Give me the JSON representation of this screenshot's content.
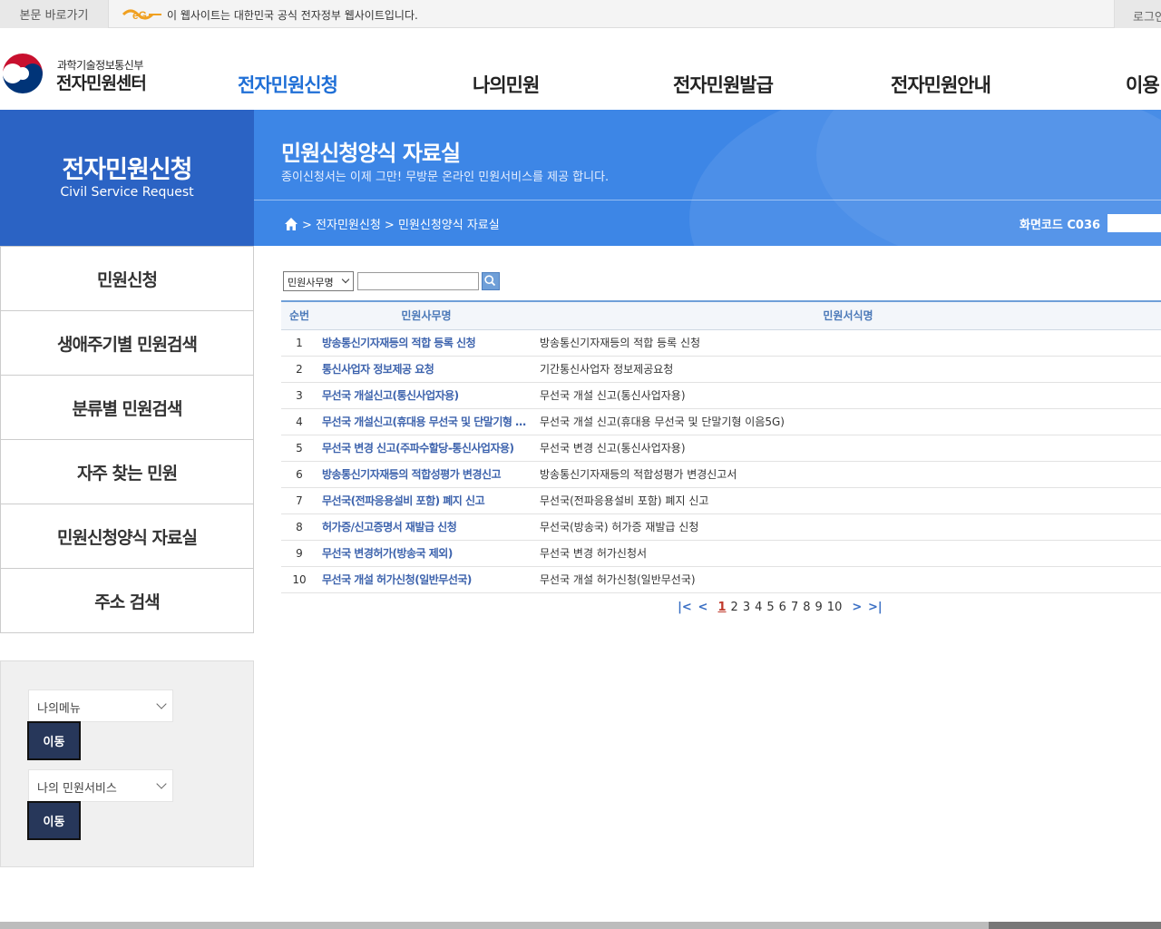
{
  "topbar": {
    "skip_link": "본문 바로가기",
    "notice": "이 웹사이트는 대한민국 공식 전자정부 웹사이트입니다.",
    "login": "로그인"
  },
  "header": {
    "ministry": "과학기술정보통신부",
    "center_name": "전자민원센터",
    "gnb": [
      "전자민원신청",
      "나의민원",
      "전자민원발급",
      "전자민원안내",
      "이용"
    ]
  },
  "left_title": {
    "ko": "전자민원신청",
    "en": "Civil Service Request"
  },
  "banner": {
    "title": "민원신청양식 자료실",
    "subtitle": "종이신청서는 이제 그만! 무방문 온라인 민원서비스를 제공 합니다.",
    "breadcrumb": "> 전자민원신청 > 민원신청양식 자료실",
    "screen_code": "화면코드 C036"
  },
  "lnb": [
    "민원신청",
    "생애주기별 민원검색",
    "분류별 민원검색",
    "자주 찾는 민원",
    "민원신청양식 자료실",
    "주소 검색"
  ],
  "mymenu": {
    "select1": "나의메뉴",
    "select2": "나의 민원서비스",
    "go_label": "이동"
  },
  "search": {
    "select_value": "민원사무명",
    "input_value": ""
  },
  "table": {
    "headers": [
      "순번",
      "민원사무명",
      "민원서식명"
    ],
    "rows": [
      {
        "num": "1",
        "name": "방송통신기자재등의 적합 등록 신청",
        "form": "방송통신기자재등의 적합 등록 신청"
      },
      {
        "num": "2",
        "name": "통신사업자 정보제공 요청",
        "form": "기간통신사업자 정보제공요청"
      },
      {
        "num": "3",
        "name": "무선국 개설신고(통신사업자용)",
        "form": "무선국 개설 신고(통신사업자용)"
      },
      {
        "num": "4",
        "name": "무선국 개설신고(휴대용 무선국 및 단말기형 이음…",
        "form": "무선국 개설 신고(휴대용 무선국 및 단말기형 이음5G)"
      },
      {
        "num": "5",
        "name": "무선국 변경 신고(주파수할당-통신사업자용)",
        "form": "무선국 변경 신고(통신사업자용)"
      },
      {
        "num": "6",
        "name": "방송통신기자재등의 적합성평가 변경신고",
        "form": "방송통신기자재등의 적합성평가 변경신고서"
      },
      {
        "num": "7",
        "name": "무선국(전파응용설비 포함) 폐지 신고",
        "form": "무선국(전파응용설비 포함) 폐지 신고"
      },
      {
        "num": "8",
        "name": "허가증/신고증명서 재발급 신청",
        "form": "무선국(방송국) 허가증 재발급 신청"
      },
      {
        "num": "9",
        "name": "무선국 변경허가(방송국 제외)",
        "form": "무선국 변경 허가신청서"
      },
      {
        "num": "10",
        "name": "무선국 개설 허가신청(일반무선국)",
        "form": "무선국 개설 허가신청(일반무선국)"
      }
    ]
  },
  "pager": {
    "pages": [
      "1",
      "2",
      "3",
      "4",
      "5",
      "6",
      "7",
      "8",
      "9",
      "10"
    ],
    "current": "1"
  },
  "colors": {
    "brand_blue": "#2b63c4",
    "banner_blue": "#3d86e6",
    "active_menu": "#1f6fd6",
    "button_navy": "#27375a"
  }
}
